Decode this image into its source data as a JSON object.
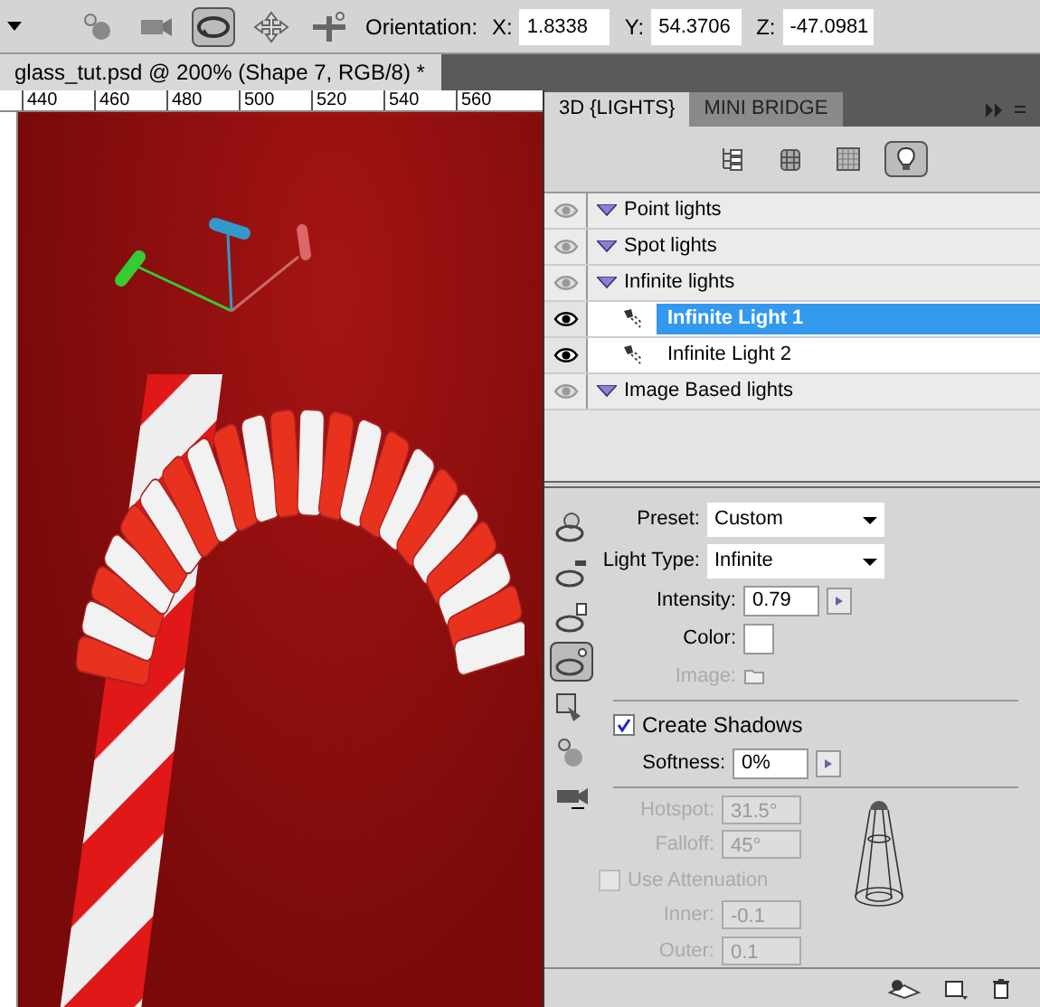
{
  "options_bar": {
    "tools": [
      {
        "kind": "rotate",
        "selected": false
      },
      {
        "kind": "camera",
        "selected": false
      },
      {
        "kind": "orbit",
        "selected": true
      },
      {
        "kind": "pan",
        "selected": false
      },
      {
        "kind": "slide",
        "selected": false
      }
    ],
    "orientation_label": "Orientation:",
    "fields": [
      {
        "label": "X:",
        "value": "1.8338"
      },
      {
        "label": "Y:",
        "value": "54.3706"
      },
      {
        "label": "Z:",
        "value": "-47.0981"
      }
    ]
  },
  "document_tab": {
    "title": "glass_tut.psd @ 200% (Shape 7, RGB/8) *"
  },
  "ruler": {
    "labels": [
      "440",
      "460",
      "480",
      "500",
      "520",
      "540",
      "560"
    ]
  },
  "panel": {
    "tabs": [
      {
        "label": "3D {LIGHTS}",
        "selected": true
      },
      {
        "label": "MINI BRIDGE",
        "selected": false
      }
    ],
    "filters": [
      {
        "kind": "scene",
        "selected": false
      },
      {
        "kind": "mesh",
        "selected": false
      },
      {
        "kind": "material",
        "selected": false
      },
      {
        "kind": "light",
        "selected": true
      }
    ],
    "lights": [
      {
        "label": "Point lights",
        "selected": false
      },
      {
        "label": "Spot lights",
        "selected": false
      },
      {
        "label": "Infinite lights",
        "selected": false,
        "children": [
          {
            "label": "Infinite Light 1",
            "selected": true
          },
          {
            "label": "Infinite Light 2",
            "selected": false
          }
        ]
      },
      {
        "label": "Image Based lights",
        "selected": false
      }
    ],
    "tools": [
      {
        "selected": false
      },
      {
        "selected": false
      },
      {
        "selected": false
      },
      {
        "selected": true
      },
      {
        "selected": false
      },
      {
        "selected": false
      },
      {
        "selected": false
      }
    ],
    "properties": {
      "preset": {
        "label": "Preset:",
        "value": "Custom"
      },
      "light_type": {
        "label": "Light Type:",
        "value": "Infinite"
      },
      "intensity": {
        "label": "Intensity:",
        "value": "0.79"
      },
      "color": {
        "label": "Color:",
        "color": "#ffffff"
      },
      "image": {
        "label": "Image:",
        "disabled": true
      },
      "create_shadows": {
        "label": "Create Shadows",
        "checked": true
      },
      "softness": {
        "label": "Softness:",
        "value": "0%"
      },
      "hotspot": {
        "label": "Hotspot:",
        "value": "31.5°",
        "disabled": true
      },
      "falloff": {
        "label": "Falloff:",
        "value": "45°",
        "disabled": true
      },
      "use_attenuation": {
        "label": "Use Attenuation",
        "checked": false,
        "disabled": true
      },
      "inner": {
        "label": "Inner:",
        "value": "-0.1",
        "disabled": true
      },
      "outer": {
        "label": "Outer:",
        "value": "0.1",
        "disabled": true
      }
    }
  }
}
